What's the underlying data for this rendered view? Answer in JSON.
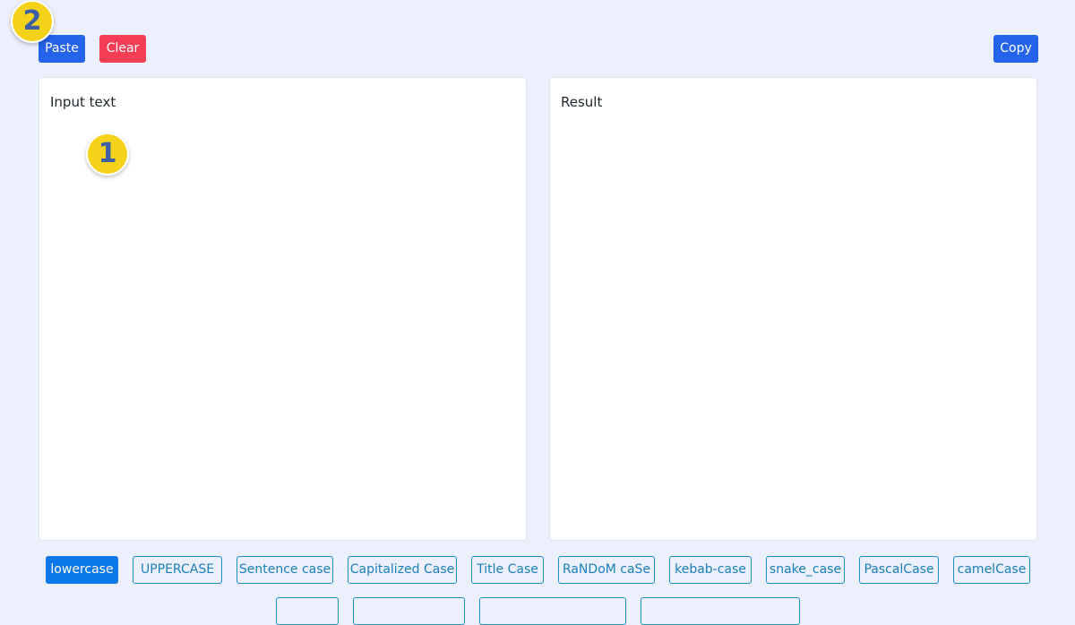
{
  "toolbar": {
    "paste_label": "Paste",
    "clear_label": "Clear",
    "copy_label": "Copy"
  },
  "input_panel": {
    "label": "Input text"
  },
  "result_panel": {
    "label": "Result"
  },
  "annotations": {
    "badge_1": "1",
    "badge_2": "2"
  },
  "case_buttons": [
    {
      "label": "lowercase",
      "active": true
    },
    {
      "label": "UPPERCASE",
      "active": false
    },
    {
      "label": "Sentence case",
      "active": false
    },
    {
      "label": "Capitalized Case",
      "active": false
    },
    {
      "label": "Title Case",
      "active": false
    },
    {
      "label": "RaNDoM caSe",
      "active": false
    },
    {
      "label": "kebab-case",
      "active": false
    },
    {
      "label": "snake_case",
      "active": false
    },
    {
      "label": "PascalCase",
      "active": false
    },
    {
      "label": "camelCase",
      "active": false
    }
  ],
  "colors": {
    "background": "#eceffc",
    "primary": "#2563eb",
    "danger": "#f43e55",
    "outline": "#1b8fc7",
    "badge": "#f5d21a"
  }
}
